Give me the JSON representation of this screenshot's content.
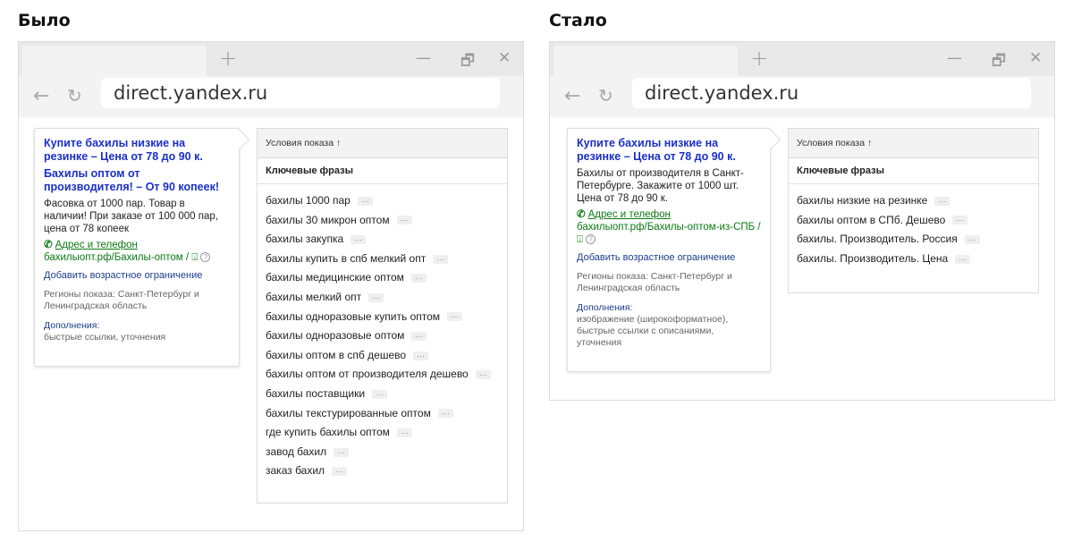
{
  "before": {
    "heading": "Было",
    "browser": {
      "plus": "+",
      "minimize": "—",
      "restore": "🗗",
      "close": "✕",
      "back": "←",
      "reload": "↻",
      "url": "direct.yandex.ru"
    },
    "ad": {
      "title1": "Купите бахилы низкие на резинке – Цена от 78 до 90 к.",
      "title2": "Бахилы оптом от производителя! – От 90 копеек!",
      "text": "Фасовка от 1000 пар. Товар в наличии! При заказе от 100 000 пар, цена от 78 копеек",
      "address": "Адрес и телефон",
      "display_link": "бахилыопт.рф/Бахилы-оптом / ",
      "age_restriction": "Добавить возрастное ограничение",
      "regions": "Регионы показа: Санкт-Петербург и Ленинградская область",
      "extensions_label": "Дополнения:",
      "extensions": "быстрые ссылки, уточнения"
    },
    "conditions_header": "Условия показа ↑",
    "keywords_header": "Ключевые фразы",
    "keywords": [
      "бахилы 1000 пар",
      "бахилы 30 микрон оптом",
      "бахилы закупка",
      "бахилы купить в спб мелкий опт",
      "бахилы медицинские оптом",
      "бахилы мелкий опт",
      "бахилы одноразовые купить оптом",
      "бахилы одноразовые оптом",
      "бахилы оптом в спб дешево",
      "бахилы оптом от производителя дешево",
      "бахилы поставщики",
      "бахилы текстурированные оптом",
      "где купить бахилы оптом",
      "завод бахил",
      "заказ бахил"
    ]
  },
  "after": {
    "heading": "Стало",
    "browser": {
      "plus": "+",
      "minimize": "—",
      "restore": "🗗",
      "close": "✕",
      "back": "←",
      "reload": "↻",
      "url": "direct.yandex.ru"
    },
    "ad": {
      "title1": "Купите бахилы низкие на резинке – Цена от 78 до 90 к.",
      "text": "Бахилы от производителя в Санкт-Петербурге. Закажите от 1000 шт. Цена от 78 до 90 к.",
      "address": "Адрес и телефон",
      "display_link": "бахилыопт.рф/Бахилы-оптом-из-СПБ / ",
      "age_restriction": "Добавить возрастное ограничение",
      "regions": "Регионы показа: Санкт-Петербург и Ленинградская область",
      "extensions_label": "Дополнения:",
      "extensions": "изображение (широкоформатное), быстрые ссылки с описаниями, уточнения"
    },
    "conditions_header": "Условия показа ↑",
    "keywords_header": "Ключевые фразы",
    "keywords": [
      "бахилы низкие на резинке",
      "бахилы оптом в СПб. Дешево",
      "бахилы. Производитель. Россия",
      "бахилы. Производитель. Цена"
    ]
  },
  "more_button": "···",
  "icons": {
    "phone": "phone-icon",
    "info": "info-icon",
    "download": "download-icon"
  },
  "colors": {
    "ad_title": "#1a2fc7",
    "ad_link": "#0b7a14",
    "age_link": "#1b3d8c"
  }
}
